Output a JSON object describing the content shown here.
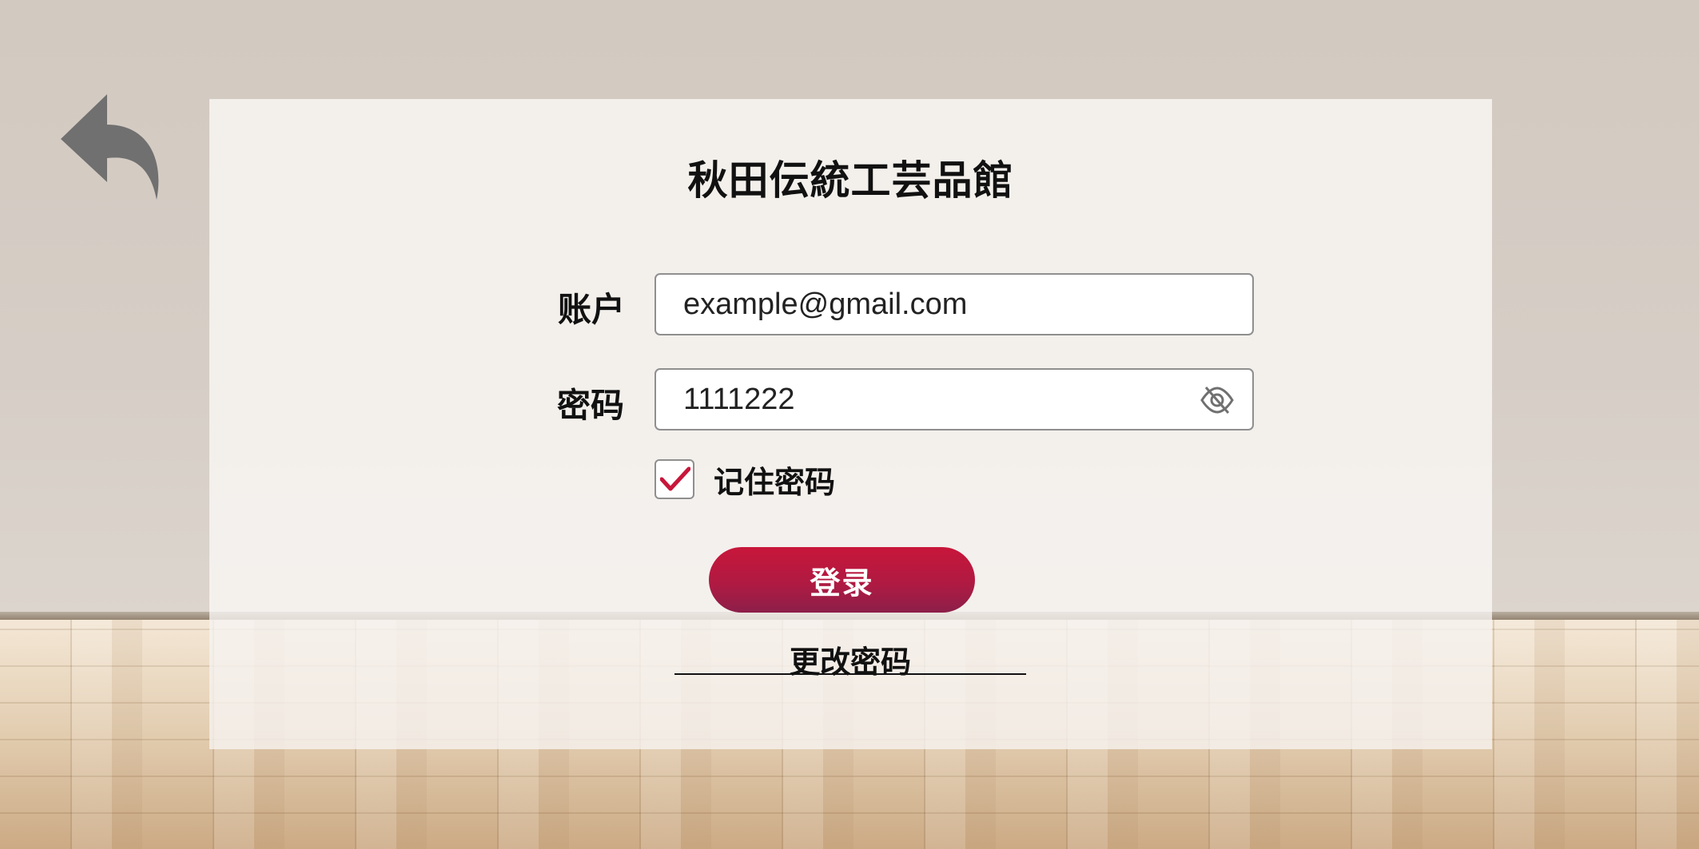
{
  "app": {
    "title": "秋田伝統工芸品館"
  },
  "nav": {
    "back_icon": "back-arrow-icon"
  },
  "form": {
    "account_label": "账户",
    "account_value": "example@gmail.com",
    "password_label": "密码",
    "password_value": "1111222",
    "password_toggle_icon": "eye-slash-icon",
    "remember_label": "记住密码",
    "remember_checked": true,
    "login_label": "登录",
    "change_password_label": "更改密码"
  },
  "colors": {
    "accent": "#c8163a",
    "accent_dark": "#8c1f49",
    "icon_gray": "#707070"
  }
}
